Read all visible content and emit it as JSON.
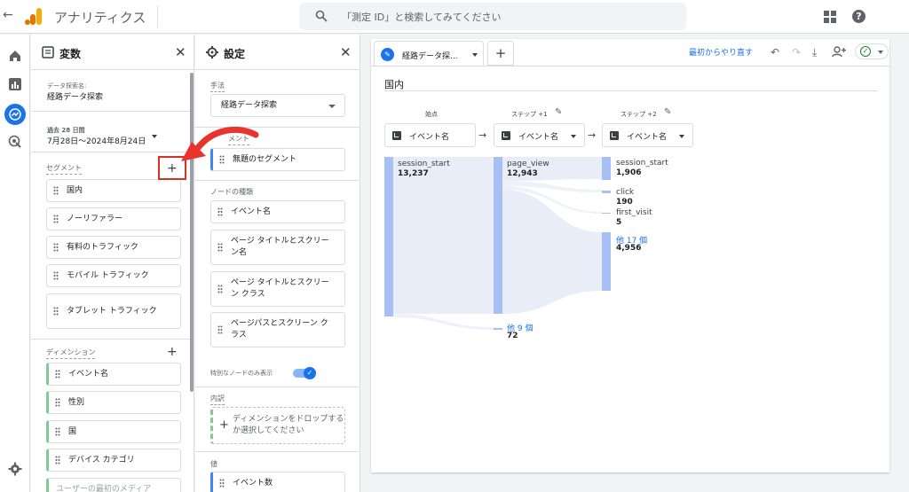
{
  "topbar": {
    "app_title": "アナリティクス",
    "search_placeholder": "「測定 ID」と検索してみてください"
  },
  "variables": {
    "title": "変数",
    "exploration_name_label": "データ探索名:",
    "exploration_name": "経路データ探索",
    "date_period": "過去 28 日間",
    "date_range": "7月28日～2024年8月24日",
    "segments_label": "セグメント",
    "segments": [
      "国内",
      "ノーリファラー",
      "有料のトラフィック",
      "モバイル トラフィック",
      "タブレット トラフィック"
    ],
    "dimensions_label": "ディメンション",
    "dimensions": [
      "イベント名",
      "性別",
      "国",
      "デバイス カテゴリ",
      "ユーザーの最初のメディア"
    ]
  },
  "settings": {
    "title": "設定",
    "technique_label": "手法",
    "technique_value": "経路データ探索",
    "segment_compare_label": "メント",
    "segment_item": "無題のセグメント",
    "node_type_label": "ノードの種類",
    "node_types": [
      "イベント名",
      "ページ タイトルとスクリーン名",
      "ページ タイトルとスクリーン クラス",
      "ページパスとスクリーン クラス"
    ],
    "special_nodes_label": "特別なノードのみ表示",
    "breakdown_label": "内訳",
    "drop_text": "ディメンションをドロップするか選択してください",
    "values_label": "値",
    "value_item": "イベント数"
  },
  "canvas": {
    "tab_label": "経路データ探...",
    "reset_label": "最初からやり直す",
    "segment_title": "国内",
    "steps": [
      {
        "label": "始点",
        "select": "イベント名"
      },
      {
        "label": "ステップ +1",
        "select": "イベント名"
      },
      {
        "label": "ステップ +2",
        "select": "イベント名"
      }
    ],
    "nodes": {
      "col1": [
        {
          "name": "session_start",
          "value": "13,237"
        }
      ],
      "col2": [
        {
          "name": "page_view",
          "value": "12,943"
        },
        {
          "name": "他 9 個",
          "value": "72"
        }
      ],
      "col3": [
        {
          "name": "session_start",
          "value": "1,906"
        },
        {
          "name": "click",
          "value": "190"
        },
        {
          "name": "first_visit",
          "value": "5"
        },
        {
          "name": "他 17 個",
          "value": "4,956"
        }
      ]
    }
  },
  "colors": {
    "accent": "#1a73e8",
    "node_bar": "#a7bff3",
    "annotation": "#d93025"
  }
}
